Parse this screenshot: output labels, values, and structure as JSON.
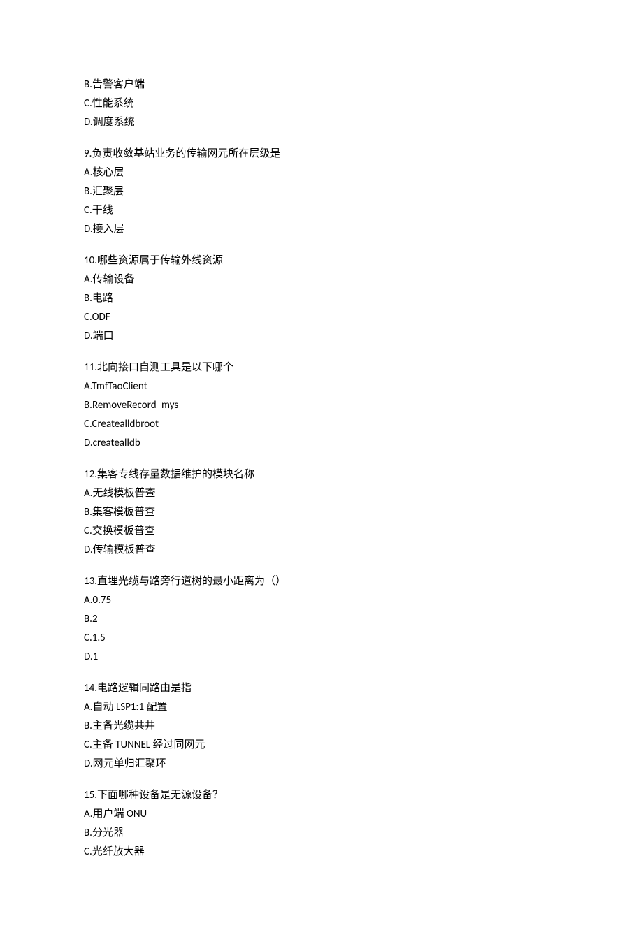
{
  "preOptions": [
    "B.告警客户端",
    "C.性能系统",
    "D.调度系统"
  ],
  "questions": [
    {
      "q": "9.负责收敛基站业务的传输网元所在层级是",
      "opts": [
        "A.核心层",
        "B.汇聚层",
        "C.干线",
        "D.接入层"
      ]
    },
    {
      "q": "10.哪些资源属于传输外线资源",
      "opts": [
        "A.传输设备",
        "B.电路",
        "C.ODF",
        "D.端口"
      ]
    },
    {
      "q": "11.北向接口自测工具是以下哪个",
      "opts": [
        "A.TmfTaoClient",
        "B.RemoveRecord_mys",
        "C.Createalldbroot",
        "D.createalldb"
      ]
    },
    {
      "q": "12.集客专线存量数据维护的模块名称",
      "opts": [
        "A.无线模板普查",
        "B.集客模板普查",
        "C.交换模板普查",
        "D.传输模板普查"
      ]
    },
    {
      "q": "13.直埋光缆与路旁行道树的最小距离为（）",
      "opts": [
        "A.0.75",
        "B.2",
        "C.1.5",
        "D.1"
      ]
    },
    {
      "q": "14.电路逻辑同路由是指",
      "opts": [
        "A.自动 LSP1:1 配置",
        "B.主备光缆共井",
        "C.主备 TUNNEL 经过同网元",
        "D.网元单归汇聚环"
      ]
    },
    {
      "q": "15.下面哪种设备是无源设备？",
      "opts": [
        "A.用户端 ONU",
        "B.分光器",
        "C.光纤放大器"
      ]
    }
  ]
}
